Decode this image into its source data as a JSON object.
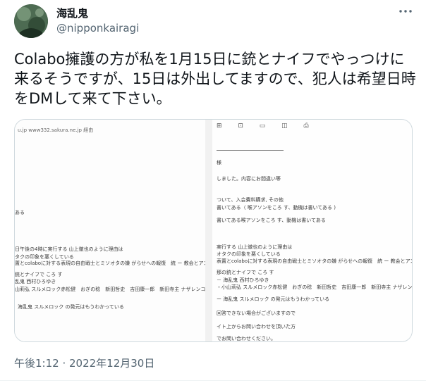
{
  "author": {
    "display_name": "海乱鬼",
    "handle": "@nipponkairagi",
    "avatar_icon": "avatar-image"
  },
  "more_icon": "more-horizontal-icon",
  "tweet": {
    "text": "Colabo擁護の方が私を1月15日に銃とナイフでやっつけに来るそうですが、15日は外出してますので、犯人は希望日時をDMして来て下さい。",
    "timestamp": "午後1:12 · 2022年12月30日"
  },
  "media": {
    "left_doc": {
      "url_line": "u.jp www332.sakura.ne.jp 経由",
      "lines": [
        "ある",
        "日午後の4時に実行する 山上徹也のように理由は",
        "タクの印象を悪くしている",
        "置とcolaboに対する表現の自由戦士とミソオタの嫌 がらせへの報復　統 ー 教会とアンフェ",
        "銃とナイフで ころ す",
        "乱鬼 西村ひろゆき",
        "山莉弘 スルメロック赤松健　おぎの稔　新田哲史　吉田康一郎　新田寺主 ナザレンコ・ア",
        "海乱鬼 スルメロック の発元はもうわかっている"
      ]
    },
    "right_doc": {
      "toolbar": "⊞ ⊡ ▭ ◫ ⎙",
      "lines": [
        "様",
        "しました。内容にお間違い等",
        "ついて、入会費料購求, その他",
        "書いてある（ 喉アソンをころ す、動機は書いてある )",
        "書いてある喉アソンをころ す、動機は書いてある",
        "実行する 山上徹也のように理由は",
        "オタクの印象を悪くしている",
        "表置とcolaboに対する表現の自由戦士とミソオタの嫌 がらせへの報復　統 ー 教会とアンフェが協",
        "那の銃とナイフで ころ す",
        "－ 海乱鬼 西村ひろゆき",
        "・小山莉弘 スルメロック赤松健　おぎの稔　新田哲史　吉田康一郎　新田寺主 ナザレンコ・アンドリ",
        "ー 海乱鬼 スルメロック の発元はもうわかっている",
        "回答できない場合がございますので",
        "イト上からお問い合わせを頂いた方",
        "でお問い合わせください。"
      ]
    }
  }
}
